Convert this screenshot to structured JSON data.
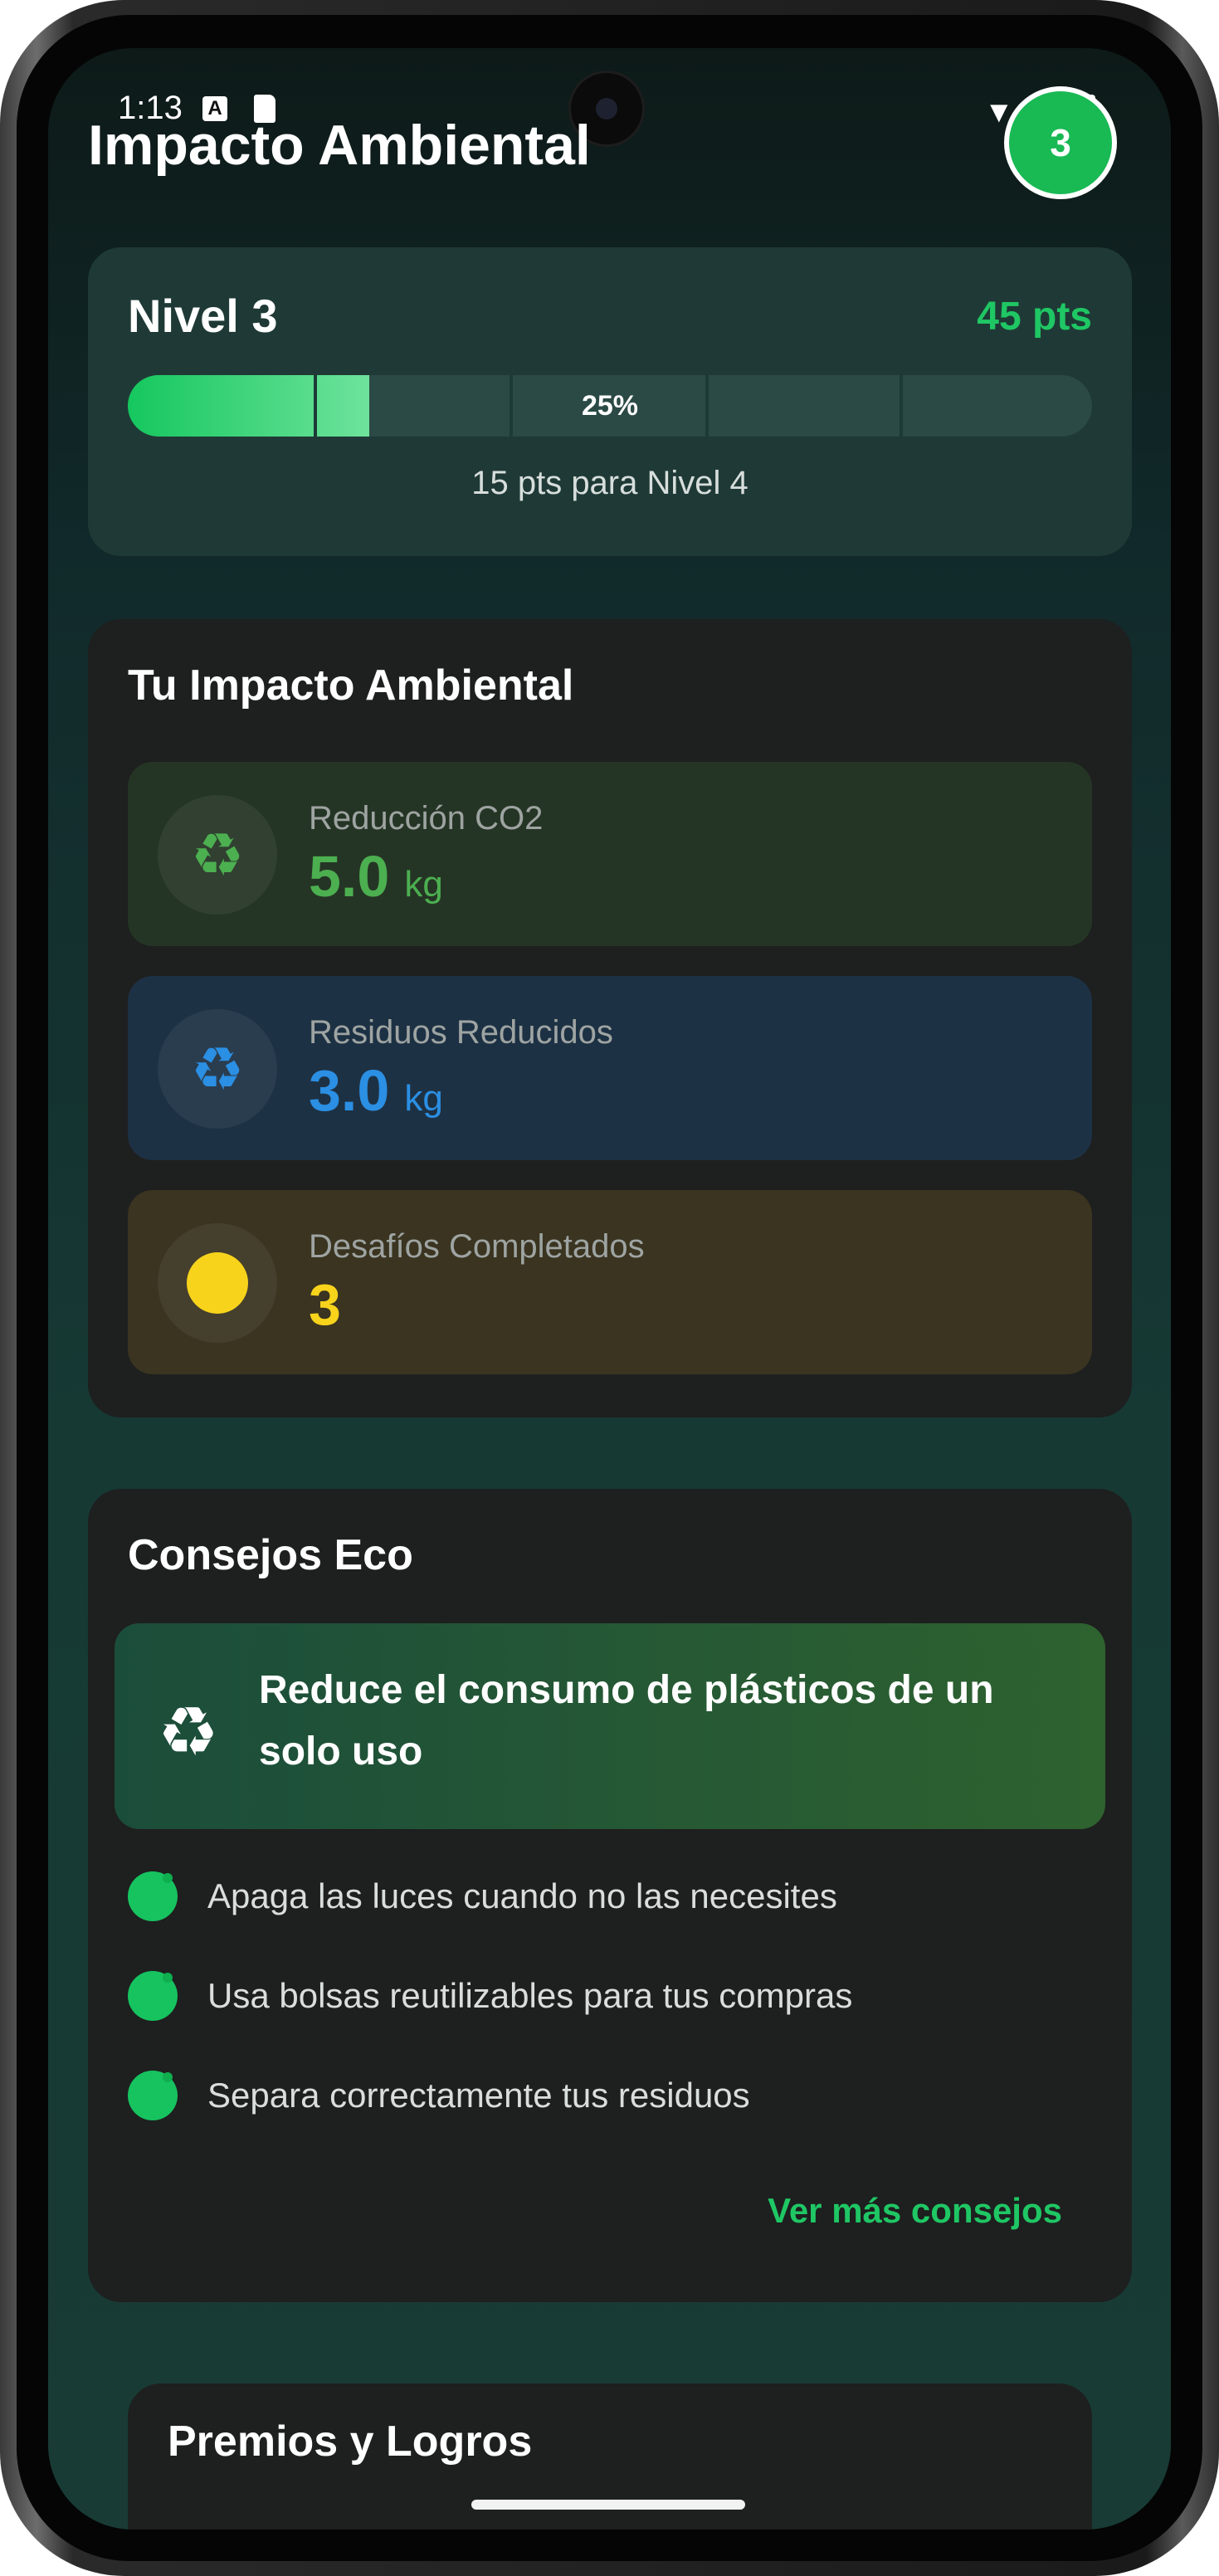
{
  "status_bar": {
    "time": "1:13",
    "icon_a": "A"
  },
  "header": {
    "title": "Impacto Ambiental",
    "level_badge": "3"
  },
  "level_card": {
    "title": "Nivel 3",
    "points": "45 pts",
    "progress_label": "25%",
    "progress_fraction": 0.25,
    "next_level_text": "15 pts para Nivel 4"
  },
  "impact": {
    "title": "Tu Impacto Ambiental",
    "metrics": [
      {
        "label": "Reducción CO2",
        "value": "5.0",
        "unit": "kg",
        "icon": "recycle-icon",
        "color": "#4caf50",
        "bg": "#253525"
      },
      {
        "label": "Residuos Reducidos",
        "value": "3.0",
        "unit": "kg",
        "icon": "recycle-icon",
        "color": "#2b8fe3",
        "bg": "#1d3144"
      },
      {
        "label": "Desafíos Completados",
        "value": "3",
        "icon": "sun-icon",
        "color": "#f7d31c",
        "bg": "#3a3420"
      }
    ]
  },
  "tips": {
    "title": "Consejos Eco",
    "featured": "Reduce el consumo de plásticos de un solo uso",
    "items": [
      "Apaga las luces cuando no las necesites",
      "Usa bolsas reutilizables para tus compras",
      "Separa correctamente tus residuos"
    ],
    "more_link": "Ver más consejos"
  },
  "rewards": {
    "title": "Premios y Logros"
  },
  "colors": {
    "accent": "#1fc764",
    "background": "#163934",
    "card": "#1e1f1f"
  }
}
